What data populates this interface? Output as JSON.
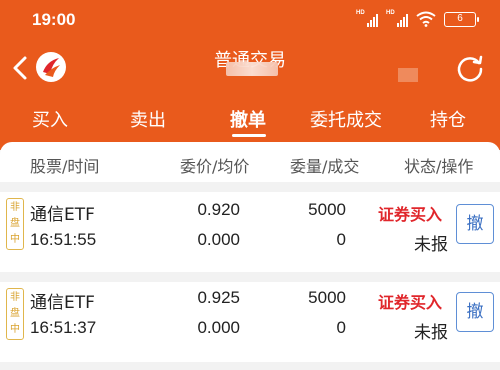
{
  "status_bar": {
    "time": "19:00",
    "battery": "6",
    "signal_labels": [
      "HD",
      "HD"
    ]
  },
  "nav": {
    "title": "普通交易"
  },
  "tabs": [
    "买入",
    "卖出",
    "撤单",
    "委托成交",
    "持仓"
  ],
  "active_tab": "撤单",
  "columns": [
    "股票/时间",
    "委价/均价",
    "委量/成交",
    "状态/操作"
  ],
  "orders": [
    {
      "tag": "非盘中",
      "name": "通信ETF",
      "time": "16:51:55",
      "order_price": "0.920",
      "avg_price": "0.000",
      "order_qty": "5000",
      "filled_qty": "0",
      "direction": "证券买入",
      "state": "未报",
      "action": "撤"
    },
    {
      "tag": "非盘中",
      "name": "通信ETF",
      "time": "16:51:37",
      "order_price": "0.925",
      "avg_price": "0.000",
      "order_qty": "5000",
      "filled_qty": "0",
      "direction": "证券买入",
      "state": "未报",
      "action": "撤"
    }
  ],
  "colors": {
    "brand": "#e95a1c",
    "sell_buy_red": "#e0262b",
    "tag_gold": "#d9a22e",
    "cancel_blue": "#3a6fc2"
  },
  "icons": {
    "back": "chevron-left-icon",
    "logo": "app-logo-icon",
    "refresh": "refresh-icon",
    "wifi": "wifi-icon",
    "battery": "battery-icon"
  }
}
